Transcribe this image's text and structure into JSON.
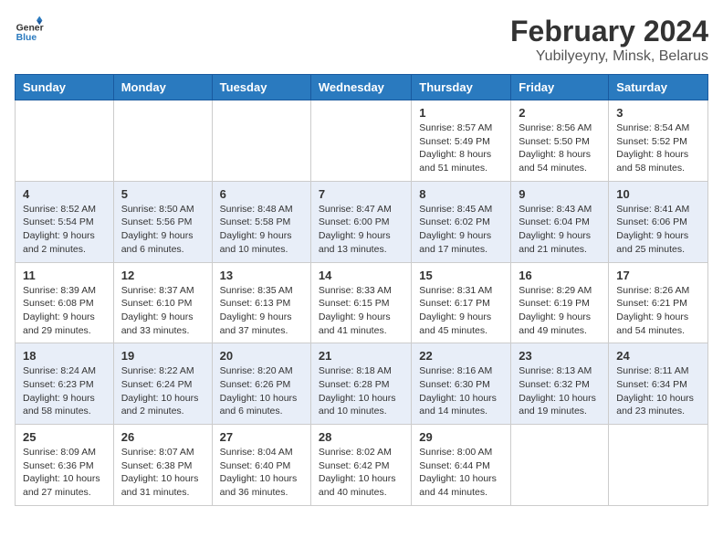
{
  "logo": {
    "line1": "General",
    "line2": "Blue"
  },
  "title": "February 2024",
  "subtitle": "Yubilyeyny, Minsk, Belarus",
  "days_header": [
    "Sunday",
    "Monday",
    "Tuesday",
    "Wednesday",
    "Thursday",
    "Friday",
    "Saturday"
  ],
  "weeks": [
    [
      {
        "day": "",
        "info": ""
      },
      {
        "day": "",
        "info": ""
      },
      {
        "day": "",
        "info": ""
      },
      {
        "day": "",
        "info": ""
      },
      {
        "day": "1",
        "info": "Sunrise: 8:57 AM\nSunset: 5:49 PM\nDaylight: 8 hours and 51 minutes."
      },
      {
        "day": "2",
        "info": "Sunrise: 8:56 AM\nSunset: 5:50 PM\nDaylight: 8 hours and 54 minutes."
      },
      {
        "day": "3",
        "info": "Sunrise: 8:54 AM\nSunset: 5:52 PM\nDaylight: 8 hours and 58 minutes."
      }
    ],
    [
      {
        "day": "4",
        "info": "Sunrise: 8:52 AM\nSunset: 5:54 PM\nDaylight: 9 hours and 2 minutes."
      },
      {
        "day": "5",
        "info": "Sunrise: 8:50 AM\nSunset: 5:56 PM\nDaylight: 9 hours and 6 minutes."
      },
      {
        "day": "6",
        "info": "Sunrise: 8:48 AM\nSunset: 5:58 PM\nDaylight: 9 hours and 10 minutes."
      },
      {
        "day": "7",
        "info": "Sunrise: 8:47 AM\nSunset: 6:00 PM\nDaylight: 9 hours and 13 minutes."
      },
      {
        "day": "8",
        "info": "Sunrise: 8:45 AM\nSunset: 6:02 PM\nDaylight: 9 hours and 17 minutes."
      },
      {
        "day": "9",
        "info": "Sunrise: 8:43 AM\nSunset: 6:04 PM\nDaylight: 9 hours and 21 minutes."
      },
      {
        "day": "10",
        "info": "Sunrise: 8:41 AM\nSunset: 6:06 PM\nDaylight: 9 hours and 25 minutes."
      }
    ],
    [
      {
        "day": "11",
        "info": "Sunrise: 8:39 AM\nSunset: 6:08 PM\nDaylight: 9 hours and 29 minutes."
      },
      {
        "day": "12",
        "info": "Sunrise: 8:37 AM\nSunset: 6:10 PM\nDaylight: 9 hours and 33 minutes."
      },
      {
        "day": "13",
        "info": "Sunrise: 8:35 AM\nSunset: 6:13 PM\nDaylight: 9 hours and 37 minutes."
      },
      {
        "day": "14",
        "info": "Sunrise: 8:33 AM\nSunset: 6:15 PM\nDaylight: 9 hours and 41 minutes."
      },
      {
        "day": "15",
        "info": "Sunrise: 8:31 AM\nSunset: 6:17 PM\nDaylight: 9 hours and 45 minutes."
      },
      {
        "day": "16",
        "info": "Sunrise: 8:29 AM\nSunset: 6:19 PM\nDaylight: 9 hours and 49 minutes."
      },
      {
        "day": "17",
        "info": "Sunrise: 8:26 AM\nSunset: 6:21 PM\nDaylight: 9 hours and 54 minutes."
      }
    ],
    [
      {
        "day": "18",
        "info": "Sunrise: 8:24 AM\nSunset: 6:23 PM\nDaylight: 9 hours and 58 minutes."
      },
      {
        "day": "19",
        "info": "Sunrise: 8:22 AM\nSunset: 6:24 PM\nDaylight: 10 hours and 2 minutes."
      },
      {
        "day": "20",
        "info": "Sunrise: 8:20 AM\nSunset: 6:26 PM\nDaylight: 10 hours and 6 minutes."
      },
      {
        "day": "21",
        "info": "Sunrise: 8:18 AM\nSunset: 6:28 PM\nDaylight: 10 hours and 10 minutes."
      },
      {
        "day": "22",
        "info": "Sunrise: 8:16 AM\nSunset: 6:30 PM\nDaylight: 10 hours and 14 minutes."
      },
      {
        "day": "23",
        "info": "Sunrise: 8:13 AM\nSunset: 6:32 PM\nDaylight: 10 hours and 19 minutes."
      },
      {
        "day": "24",
        "info": "Sunrise: 8:11 AM\nSunset: 6:34 PM\nDaylight: 10 hours and 23 minutes."
      }
    ],
    [
      {
        "day": "25",
        "info": "Sunrise: 8:09 AM\nSunset: 6:36 PM\nDaylight: 10 hours and 27 minutes."
      },
      {
        "day": "26",
        "info": "Sunrise: 8:07 AM\nSunset: 6:38 PM\nDaylight: 10 hours and 31 minutes."
      },
      {
        "day": "27",
        "info": "Sunrise: 8:04 AM\nSunset: 6:40 PM\nDaylight: 10 hours and 36 minutes."
      },
      {
        "day": "28",
        "info": "Sunrise: 8:02 AM\nSunset: 6:42 PM\nDaylight: 10 hours and 40 minutes."
      },
      {
        "day": "29",
        "info": "Sunrise: 8:00 AM\nSunset: 6:44 PM\nDaylight: 10 hours and 44 minutes."
      },
      {
        "day": "",
        "info": ""
      },
      {
        "day": "",
        "info": ""
      }
    ]
  ]
}
